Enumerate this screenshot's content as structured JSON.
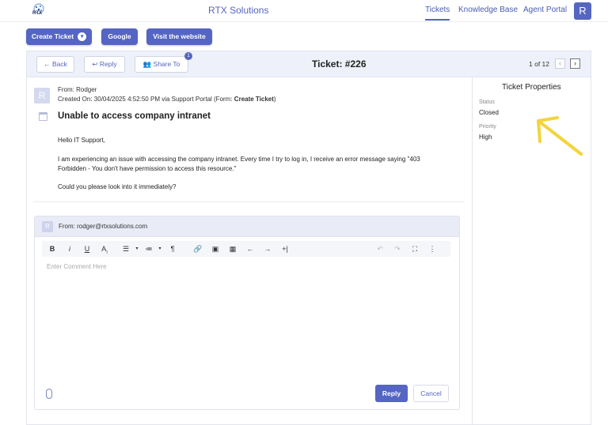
{
  "app": {
    "logo_text": "RTX",
    "brand": "RTX Solutions",
    "nav": [
      "Tickets",
      "Knowledge Base",
      "Agent Portal"
    ],
    "active_nav": "Tickets",
    "user_initial": "R"
  },
  "actions": {
    "create_ticket": "Create Ticket",
    "google": "Google",
    "visit_website": "Visit the website"
  },
  "ticket_header": {
    "back": "Back",
    "reply": "Reply",
    "share": "Share To",
    "share_count": "1",
    "title": "Ticket: #226",
    "pager": "1 of 12"
  },
  "message": {
    "avatar": "R",
    "from": "From: Rodger",
    "created_prefix": "Created On: 30/04/2025 4:52:50 PM via Support Portal (Form: ",
    "created_form": "Create Ticket",
    "created_suffix": ")",
    "subject": "Unable to access company intranet",
    "greeting": "Hello IT Support,",
    "body": "I am experiencing an issue with accessing the company intranet. Every time I try to log in, I receive an error message saying \"403 Forbidden - You don't have permission to access this resource.\"",
    "closing": "Could you please look into it immediately?"
  },
  "properties": {
    "title": "Ticket Properties",
    "status_label": "Status",
    "status_value": "Closed",
    "priority_label": "Priority",
    "priority_value": "High"
  },
  "reply_box": {
    "avatar": "R",
    "from": "From: rodger@rtxsolutions.com",
    "placeholder": "Enter Comment Here",
    "reply_label": "Reply",
    "cancel_label": "Cancel",
    "toolbar": [
      "B",
      "i",
      "U",
      "A",
      "list-ordered-icon",
      "list-bullet-icon",
      "paragraph-icon",
      "link-icon",
      "image-icon",
      "table-icon",
      "outdent-icon",
      "indent-icon",
      "horizontal-rule-icon",
      "undo-icon",
      "redo-icon",
      "fullscreen-icon",
      "more-icon"
    ]
  },
  "colors": {
    "accent": "#5565c3",
    "annotation_arrow": "#f5d33a"
  }
}
